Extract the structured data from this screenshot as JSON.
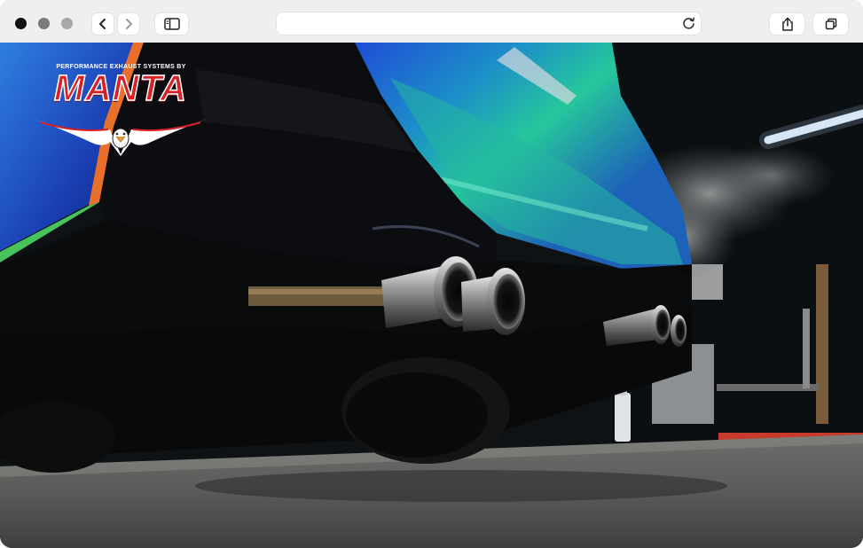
{
  "browser": {
    "url": "",
    "icons": {
      "back": "chevron-left-icon",
      "forward": "chevron-right-icon",
      "sidebar": "sidebar-icon",
      "reload": "reload-icon",
      "share": "share-icon",
      "tabs": "tabs-icon"
    }
  },
  "hero": {
    "logo": {
      "tagline": "PERFORMANCE EXHAUST SYSTEMS BY",
      "name": "MANTA"
    },
    "colors": {
      "brand_red": "#d72127",
      "car_blue": "#1f3fc8",
      "car_green": "#27c9a0"
    }
  }
}
